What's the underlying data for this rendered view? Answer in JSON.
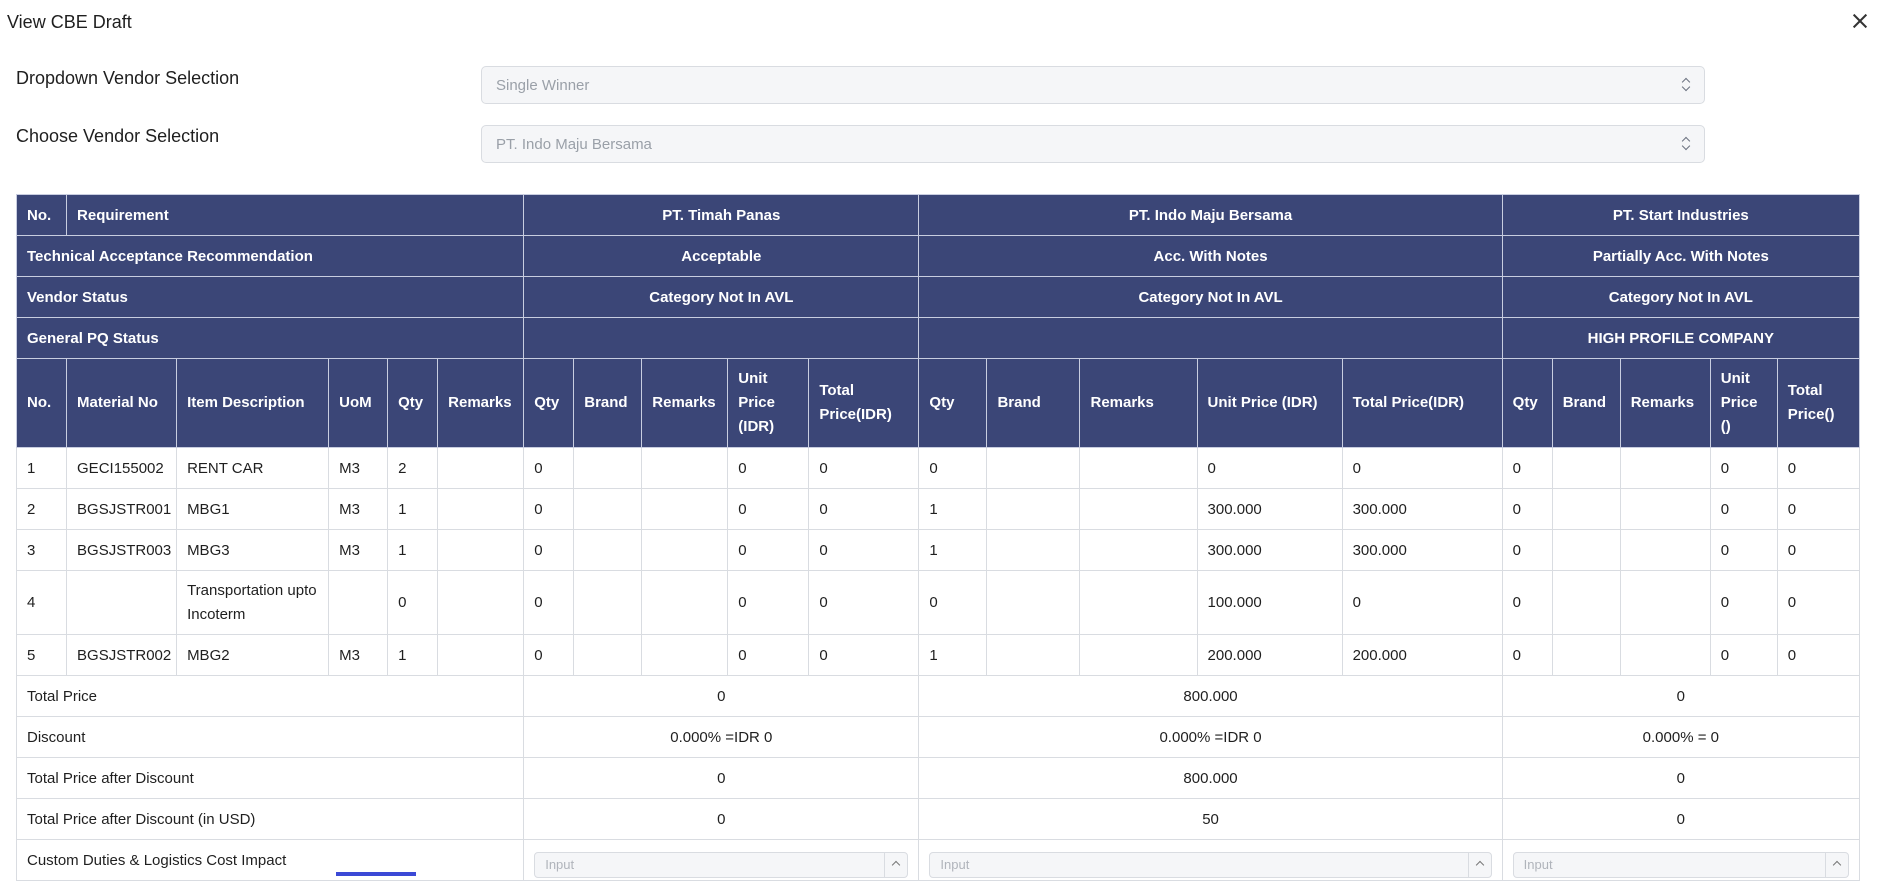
{
  "dialog": {
    "title": "View CBE Draft"
  },
  "form": {
    "dropdown_vendor_selection": {
      "label": "Dropdown Vendor Selection",
      "value": "Single Winner"
    },
    "choose_vendor_selection": {
      "label": "Choose Vendor Selection",
      "value": "PT. Indo Maju Bersama"
    }
  },
  "table": {
    "no_label": "No.",
    "requirement_label": "Requirement",
    "vendors": [
      {
        "name": "PT. Timah Panas",
        "technical": "Acceptable",
        "status": "Category Not In AVL",
        "pq": "",
        "unit_price_header": "Unit Price (IDR)",
        "total_price_header": "Total Price(IDR)"
      },
      {
        "name": "PT. Indo Maju Bersama",
        "technical": "Acc. With Notes",
        "status": "Category Not In AVL",
        "pq": "",
        "unit_price_header": "Unit Price (IDR)",
        "total_price_header": "Total Price(IDR)"
      },
      {
        "name": "PT. Start Industries",
        "technical": "Partially Acc. With Notes",
        "status": "Category Not In AVL",
        "pq": "HIGH PROFILE COMPANY",
        "unit_price_header": "Unit Price ()",
        "total_price_header": "Total Price()"
      }
    ],
    "row_labels": {
      "technical": "Technical Acceptance Recommendation",
      "vendor_status": "Vendor Status",
      "pq_status": "General PQ Status"
    },
    "columns": {
      "no": "No.",
      "material_no": "Material No",
      "item_description": "Item Description",
      "uom": "UoM",
      "qty": "Qty",
      "remarks": "Remarks",
      "v_qty": "Qty",
      "v_brand": "Brand",
      "v_remarks": "Remarks"
    },
    "items": [
      {
        "no": "1",
        "material": "GECI155002",
        "desc": "RENT CAR",
        "uom": "M3",
        "qty": "2",
        "remarks": "",
        "v": [
          [
            "0",
            "",
            "",
            "0",
            "0"
          ],
          [
            "0",
            "",
            "",
            "0",
            "0"
          ],
          [
            "0",
            "",
            "",
            "0",
            "0"
          ]
        ]
      },
      {
        "no": "2",
        "material": "BGSJSTR001",
        "desc": "MBG1",
        "uom": "M3",
        "qty": "1",
        "remarks": "",
        "v": [
          [
            "0",
            "",
            "",
            "0",
            "0"
          ],
          [
            "1",
            "",
            "",
            "300.000",
            "300.000"
          ],
          [
            "0",
            "",
            "",
            "0",
            "0"
          ]
        ]
      },
      {
        "no": "3",
        "material": "BGSJSTR003",
        "desc": "MBG3",
        "uom": "M3",
        "qty": "1",
        "remarks": "",
        "v": [
          [
            "0",
            "",
            "",
            "0",
            "0"
          ],
          [
            "1",
            "",
            "",
            "300.000",
            "300.000"
          ],
          [
            "0",
            "",
            "",
            "0",
            "0"
          ]
        ]
      },
      {
        "no": "4",
        "material": "",
        "desc": "Transportation upto Incoterm",
        "uom": "",
        "qty": "0",
        "remarks": "",
        "v": [
          [
            "0",
            "",
            "",
            "0",
            "0"
          ],
          [
            "0",
            "",
            "",
            "100.000",
            "0"
          ],
          [
            "0",
            "",
            "",
            "0",
            "0"
          ]
        ]
      },
      {
        "no": "5",
        "material": "BGSJSTR002",
        "desc": "MBG2",
        "uom": "M3",
        "qty": "1",
        "remarks": "",
        "v": [
          [
            "0",
            "",
            "",
            "0",
            "0"
          ],
          [
            "1",
            "",
            "",
            "200.000",
            "200.000"
          ],
          [
            "0",
            "",
            "",
            "0",
            "0"
          ]
        ]
      }
    ],
    "summary": [
      {
        "label": "Total Price",
        "values": [
          "0",
          "800.000",
          "0"
        ]
      },
      {
        "label": "Discount",
        "values": [
          "0.000% =IDR 0",
          "0.000% =IDR 0",
          "0.000% = 0"
        ]
      },
      {
        "label": "Total Price after Discount",
        "values": [
          "0",
          "800.000",
          "0"
        ]
      },
      {
        "label": "Total Price after Discount (in USD)",
        "values": [
          "0",
          "50",
          "0"
        ]
      }
    ],
    "custom_duties": {
      "label": "Custom Duties & Logistics Cost Impact",
      "placeholder": "Input"
    }
  }
}
